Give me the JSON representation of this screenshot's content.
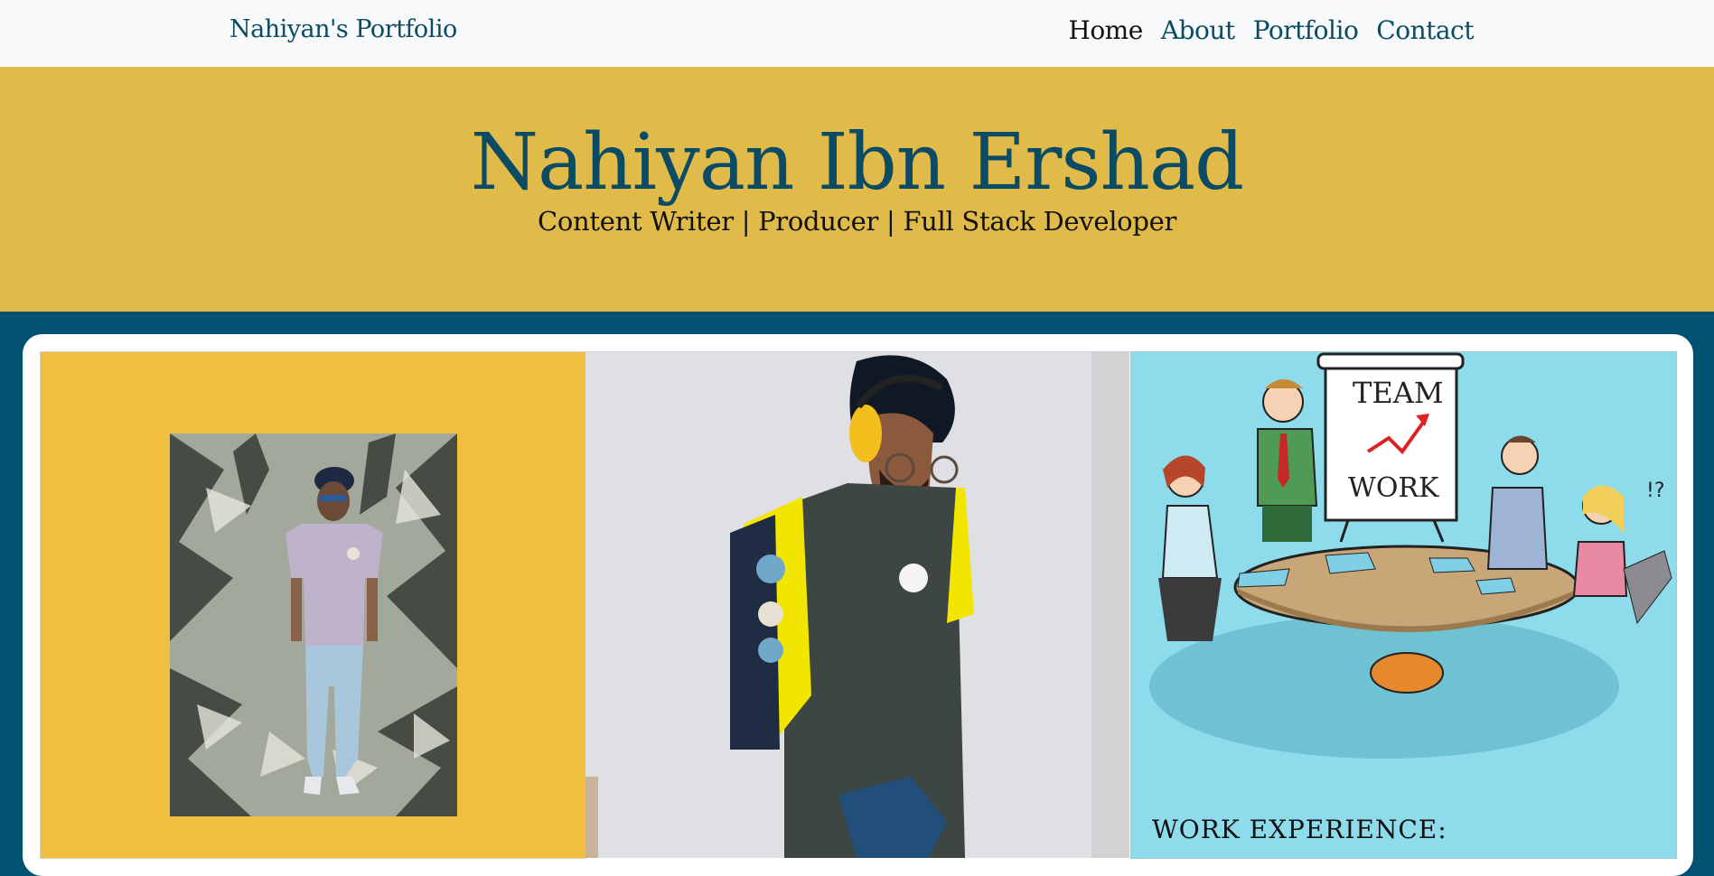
{
  "navbar": {
    "brand": "Nahiyan's Portfolio",
    "links": [
      "Home",
      "About",
      "Portfolio",
      "Contact"
    ]
  },
  "hero": {
    "name": "Nahiyan Ibn Ershad",
    "tagline": "Content Writer | Producer | Full Stack Developer"
  },
  "panels": {
    "work_title": "WORK EXPERIENCE:",
    "whiteboard_top": "TEAM",
    "whiteboard_bottom": "WORK"
  }
}
